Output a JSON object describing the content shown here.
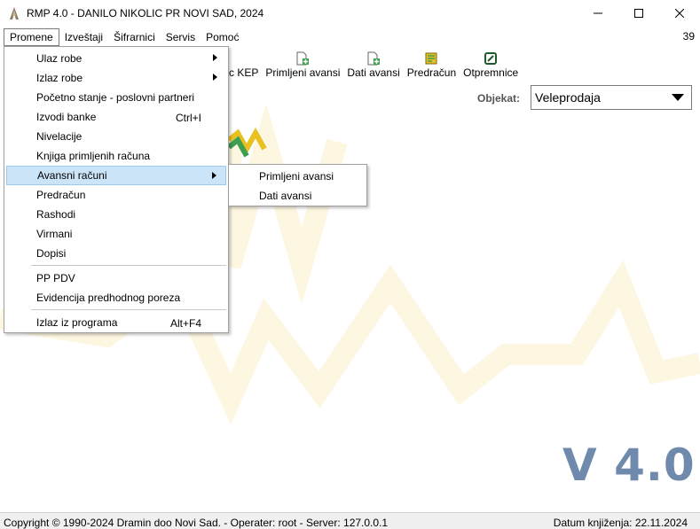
{
  "window": {
    "title": "RMP 4.0 - DANILO NIKOLIC PR NOVI SAD, 2024",
    "icon": "app-logo-icon",
    "controls": [
      "minimize-icon",
      "maximize-icon",
      "close-icon"
    ]
  },
  "menubar": {
    "items": [
      {
        "label": "Promene"
      },
      {
        "label": "Izveštaji"
      },
      {
        "label": "Šifrarnici"
      },
      {
        "label": "Servis"
      },
      {
        "label": "Pomoć"
      }
    ],
    "counter": "39"
  },
  "toolbar": {
    "partial_label": "c KEP",
    "buttons": [
      {
        "label": "Primljeni avansi",
        "icon": "doc-add-icon"
      },
      {
        "label": "Dati avansi",
        "icon": "doc-add-icon"
      },
      {
        "label": "Predračun",
        "icon": "calc-icon"
      },
      {
        "label": "Otpremnice",
        "icon": "edit-icon"
      }
    ]
  },
  "objekat": {
    "label": "Objekat:",
    "value": "Veleprodaja"
  },
  "promene_menu": {
    "items": [
      {
        "label": "Ulaz robe",
        "submenu": true,
        "shortcut": ""
      },
      {
        "label": "Izlaz robe",
        "submenu": true,
        "shortcut": ""
      },
      {
        "label": "Početno stanje - poslovni partneri",
        "submenu": false,
        "shortcut": ""
      },
      {
        "label": "Izvodi banke",
        "submenu": false,
        "shortcut": "Ctrl+I"
      },
      {
        "label": "Nivelacije",
        "submenu": false,
        "shortcut": ""
      },
      {
        "label": "Knjiga primljenih računa",
        "submenu": false,
        "shortcut": ""
      },
      {
        "label": "Avansni računi",
        "submenu": true,
        "shortcut": "",
        "highlighted": true
      },
      {
        "label": "Predračun",
        "submenu": false,
        "shortcut": ""
      },
      {
        "label": "Rashodi",
        "submenu": false,
        "shortcut": ""
      },
      {
        "label": "Virmani",
        "submenu": false,
        "shortcut": ""
      },
      {
        "label": "Dopisi",
        "submenu": false,
        "shortcut": ""
      },
      {
        "label": "PP PDV",
        "submenu": false,
        "shortcut": ""
      },
      {
        "label": "Evidencija predhodnog poreza",
        "submenu": false,
        "shortcut": ""
      },
      {
        "label": "Izlaz iz programa",
        "submenu": false,
        "shortcut": "Alt+F4"
      }
    ]
  },
  "avansni_submenu": {
    "items": [
      {
        "label": "Primljeni avansi"
      },
      {
        "label": "Dati avansi"
      }
    ]
  },
  "version": "V 4.0",
  "statusbar": {
    "left": "Copyright © 1990-2024 Dramin doo Novi Sad. - Operater: root - Server: 127.0.0.1",
    "right": "Datum knjiženja: 22.11.2024"
  },
  "colors": {
    "highlight_bg": "#cce4f7",
    "highlight_border": "#99c9ef",
    "watermark": "#fdf6e0",
    "version_text": "#6f8aac",
    "logo_green": "#3f9e52",
    "logo_yellow": "#e8c020"
  }
}
